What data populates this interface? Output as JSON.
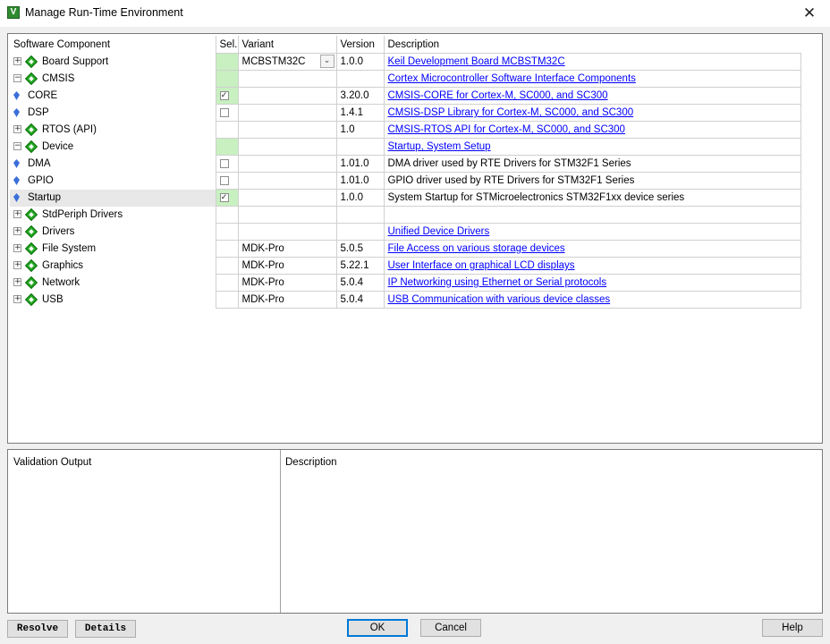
{
  "window": {
    "title": "Manage Run-Time Environment",
    "close_symbol": "✕",
    "app_icon": "keil-uvision-icon",
    "app_icon_glyph": "V"
  },
  "columns": {
    "component": "Software Component",
    "sel": "Sel.",
    "variant": "Variant",
    "version": "Version",
    "description": "Description"
  },
  "rows": [
    {
      "name": "Board Support",
      "level": 0,
      "expander": "+",
      "icon": "diamond",
      "sel": "",
      "sel_green": true,
      "variant": "MCBSTM32C",
      "variant_dropdown": true,
      "version": "1.0.0",
      "description": "Keil Development Board MCBSTM32C",
      "desc_link": true
    },
    {
      "name": "CMSIS",
      "level": 0,
      "expander": "−",
      "icon": "diamond",
      "sel": "",
      "sel_green": true,
      "variant": "",
      "version": "",
      "description": "Cortex Microcontroller Software Interface Components",
      "desc_link": true
    },
    {
      "name": "CORE",
      "level": 1,
      "expander": "",
      "icon": "gem",
      "sel": "checked",
      "sel_green": true,
      "variant": "",
      "version": "3.20.0",
      "description": "CMSIS-CORE for Cortex-M, SC000, and SC300",
      "desc_link": true
    },
    {
      "name": "DSP",
      "level": 1,
      "expander": "",
      "icon": "gem",
      "sel": "unchecked",
      "sel_green": false,
      "variant": "",
      "version": "1.4.1",
      "description": "CMSIS-DSP Library for Cortex-M, SC000, and SC300",
      "desc_link": true
    },
    {
      "name": "RTOS (API)",
      "level": 1,
      "expander": "+",
      "icon": "diamond",
      "sel": "",
      "sel_green": false,
      "variant": "",
      "version": "1.0",
      "description": "CMSIS-RTOS API for Cortex-M, SC000, and SC300",
      "desc_link": true
    },
    {
      "name": "Device",
      "level": 0,
      "expander": "−",
      "icon": "diamond",
      "sel": "",
      "sel_green": true,
      "variant": "",
      "version": "",
      "description": "Startup, System Setup",
      "desc_link": true
    },
    {
      "name": "DMA",
      "level": 1,
      "expander": "",
      "icon": "gem",
      "sel": "unchecked",
      "sel_green": false,
      "variant": "",
      "version": "1.01.0",
      "description": "DMA driver used by RTE Drivers for STM32F1 Series",
      "desc_link": false
    },
    {
      "name": "GPIO",
      "level": 1,
      "expander": "",
      "icon": "gem",
      "sel": "unchecked",
      "sel_green": false,
      "variant": "",
      "version": "1.01.0",
      "description": "GPIO driver used by RTE Drivers for STM32F1 Series",
      "desc_link": false
    },
    {
      "name": "Startup",
      "level": 1,
      "expander": "",
      "icon": "gem",
      "sel": "checked",
      "sel_green": true,
      "variant": "",
      "version": "1.0.0",
      "description": "System Startup for STMicroelectronics STM32F1xx device series",
      "desc_link": false,
      "selected": true
    },
    {
      "name": "StdPeriph Drivers",
      "level": 1,
      "expander": "+",
      "icon": "diamond",
      "sel": "",
      "sel_green": false,
      "variant": "",
      "version": "",
      "description": "",
      "desc_link": false
    },
    {
      "name": "Drivers",
      "level": 0,
      "expander": "+",
      "icon": "diamond",
      "sel": "",
      "sel_green": false,
      "variant": "",
      "version": "",
      "description": "Unified Device Drivers",
      "desc_link": true
    },
    {
      "name": "File System",
      "level": 0,
      "expander": "+",
      "icon": "diamond",
      "sel": "",
      "sel_green": false,
      "variant": "MDK-Pro",
      "version": "5.0.5",
      "description": "File Access on various storage devices",
      "desc_link": true
    },
    {
      "name": "Graphics",
      "level": 0,
      "expander": "+",
      "icon": "diamond",
      "sel": "",
      "sel_green": false,
      "variant": "MDK-Pro",
      "version": "5.22.1",
      "description": "User Interface on graphical LCD displays",
      "desc_link": true
    },
    {
      "name": "Network",
      "level": 0,
      "expander": "+",
      "icon": "diamond",
      "sel": "",
      "sel_green": false,
      "variant": "MDK-Pro",
      "version": "5.0.4",
      "description": "IP Networking using Ethernet or Serial protocols",
      "desc_link": true
    },
    {
      "name": "USB",
      "level": 0,
      "expander": "+",
      "icon": "diamond",
      "sel": "",
      "sel_green": false,
      "variant": "MDK-Pro",
      "version": "5.0.4",
      "description": "USB Communication with various device classes",
      "desc_link": true
    }
  ],
  "bottom": {
    "validation_header": "Validation Output",
    "description_header": "Description"
  },
  "buttons": {
    "resolve": "Resolve",
    "details": "Details",
    "ok": "OK",
    "cancel": "Cancel",
    "help": "Help"
  },
  "colors": {
    "selection_green": "#c8f0c0",
    "link_blue": "#0000ff",
    "component_icon_green": "#22aa22",
    "subcomponent_icon_blue": "#3a6fd8"
  }
}
